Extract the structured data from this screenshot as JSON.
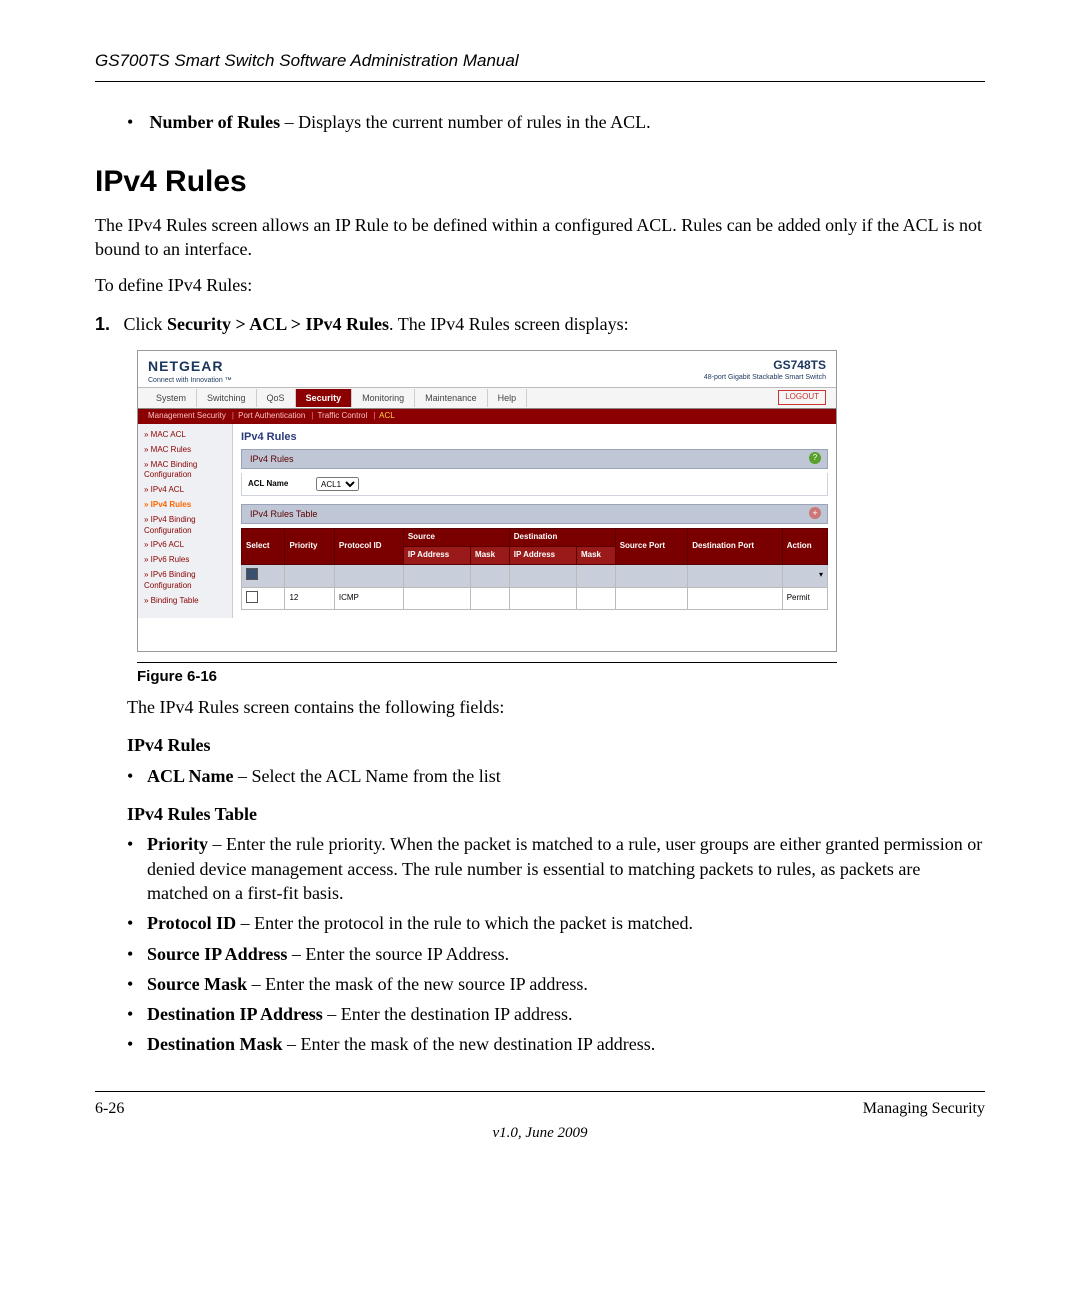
{
  "running_head": "GS700TS Smart Switch Software Administration Manual",
  "pre_bullet": {
    "term": "Number of Rules",
    "desc": " – Displays the current number of rules in the ACL."
  },
  "section_title": "IPv4 Rules",
  "intro_para": "The IPv4 Rules screen allows an IP Rule to be defined within a configured ACL. Rules can be added only if the ACL is not bound to an interface.",
  "lead_in": "To define IPv4 Rules:",
  "step1": {
    "num": "1.",
    "pre": "Click ",
    "bold": "Security > ACL > IPv4 Rules",
    "post": ". The IPv4 Rules screen displays:"
  },
  "app": {
    "logo": "NETGEAR",
    "logo_sub": "Connect with Innovation ™",
    "model": "GS748TS",
    "model_sub": "48-port Gigabit Stackable Smart Switch",
    "tabs": [
      "System",
      "Switching",
      "QoS",
      "Security",
      "Monitoring",
      "Maintenance",
      "Help"
    ],
    "active_tab": "Security",
    "logout": "LOGOUT",
    "subnav": [
      "Management Security",
      "Port Authentication",
      "Traffic Control",
      "ACL"
    ],
    "subnav_active": "ACL",
    "sidebar": [
      "» MAC ACL",
      "» MAC Rules",
      "» MAC Binding Configuration",
      "» IPv4 ACL",
      "» IPv4 Rules",
      "» IPv4 Binding Configuration",
      "» IPv6 ACL",
      "» IPv6 Rules",
      "» IPv6 Binding Configuration",
      "» Binding Table"
    ],
    "sidebar_selected": "» IPv4 Rules",
    "panel_title": "IPv4 Rules",
    "band1": "IPv4 Rules",
    "acl_label": "ACL Name",
    "acl_value": "ACL1",
    "band2": "IPv4 Rules Table",
    "headers": {
      "select": "Select",
      "priority": "Priority",
      "protocol": "Protocol ID",
      "source": "Source",
      "destination": "Destination",
      "src_port": "Source Port",
      "dst_port": "Destination Port",
      "action": "Action",
      "ipaddr": "IP Address",
      "mask": "Mask"
    },
    "rows": [
      {
        "select": "dark",
        "priority": "",
        "protocol": "",
        "sip": "",
        "smask": "",
        "dip": "",
        "dmask": "",
        "sport": "",
        "dport": "",
        "action": ""
      },
      {
        "select": "open",
        "priority": "12",
        "protocol": "ICMP",
        "sip": "",
        "smask": "",
        "dip": "",
        "dmask": "",
        "sport": "",
        "dport": "",
        "action": "Permit"
      }
    ]
  },
  "figure_caption": "Figure 6-16",
  "post_figure": "The IPv4 Rules screen contains the following fields:",
  "group1_head": "IPv4 Rules",
  "group1_items": [
    {
      "term": "ACL Name",
      "desc": " – Select the ACL Name from the list"
    }
  ],
  "group2_head": "IPv4 Rules Table",
  "group2_items": [
    {
      "term": "Priority",
      "desc": " – Enter the rule priority. When the packet is matched to a rule, user groups are either granted permission or denied device management access. The rule number is essential to matching packets to rules, as packets are matched on a first-fit basis."
    },
    {
      "term": "Protocol ID",
      "desc": " – Enter the protocol in the rule to which the packet is matched."
    },
    {
      "term": "Source IP Address",
      "desc": " – Enter the source IP Address."
    },
    {
      "term": "Source Mask",
      "desc": " – Enter the mask of the new source IP address."
    },
    {
      "term": "Destination IP Address",
      "desc": " – Enter the destination IP address."
    },
    {
      "term": "Destination Mask",
      "desc": " – Enter the mask of the new destination IP address."
    }
  ],
  "footer": {
    "left": "6-26",
    "right": "Managing Security",
    "version": "v1.0, June 2009"
  }
}
